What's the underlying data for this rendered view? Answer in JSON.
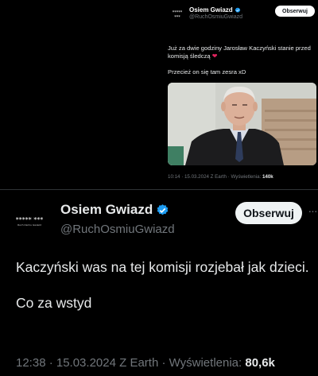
{
  "top_tweet": {
    "avatar_text": "***** ***",
    "author_name": "Osiem Gwiazd",
    "handle": "@RuchOsmiuGwiazd",
    "follow_label": "Obserwuj",
    "line1": "Już za dwie godziny Jarosław Kaczyński stanie",
    "line2": "przed komisją śledczą",
    "emoji_icon": "heart-icon",
    "line3": "Przecież on się tam zesra xD",
    "meta_time": "10:14 · 15.03.2024 Z Earth · Wyświetlenia: ",
    "meta_views": "140k"
  },
  "main_tweet": {
    "avatar_text": "***** ***",
    "avatar_sub": "Ruch Osmiu Gwiazd",
    "author_name": "Osiem Gwiazd",
    "handle": "@RuchOsmiuGwiazd",
    "follow_label": "Obserwuj",
    "more_icon": "more-horizontal-icon",
    "line1": "Kaczyński was na tej komisji rozjebał jak dzieci.",
    "line2": "Co za wstyd",
    "meta_time": "12:38 · 15.03.2024 Z Earth · Wyświetlenia: ",
    "meta_views": "80,6k"
  },
  "colors": {
    "background": "#000000",
    "verified_blue": "#1d9bf0",
    "secondary_text": "#71767b",
    "heart": "#e0245e"
  }
}
